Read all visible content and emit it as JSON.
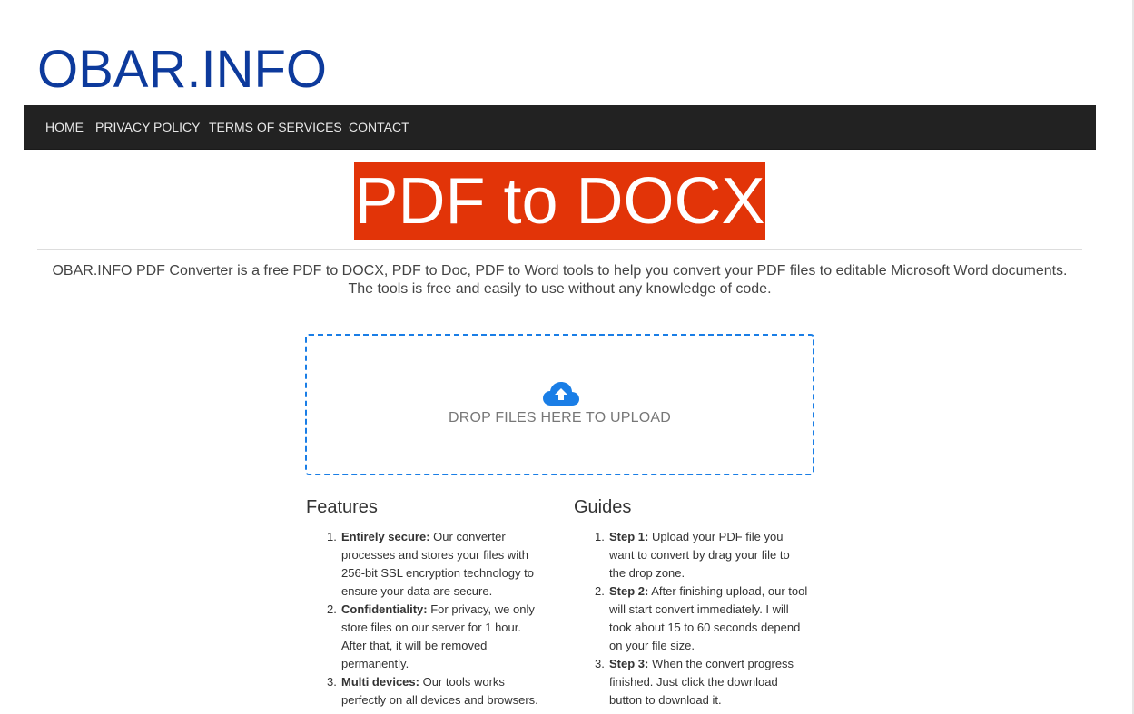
{
  "site": {
    "title": "OBAR.INFO"
  },
  "nav": {
    "items": [
      {
        "label": "HOME"
      },
      {
        "label": "PRIVACY POLICY"
      },
      {
        "label": "TERMS OF SERVICES"
      },
      {
        "label": "CONTACT"
      }
    ]
  },
  "hero": {
    "banner": "PDF to DOCX",
    "intro_line1": "OBAR.INFO PDF Converter is a free PDF to DOCX, PDF to Doc, PDF to Word tools to help you convert your PDF files to editable Microsoft Word documents.",
    "intro_line2": "The tools is free and easily to use without any knowledge of code."
  },
  "dropzone": {
    "icon": "cloud-upload-icon",
    "label": "DROP FILES HERE TO UPLOAD"
  },
  "features": {
    "heading": "Features",
    "items": [
      {
        "num": "1.",
        "title": "Entirely secure:",
        "text": "Our converter processes and stores your files with 256-bit SSL encryption technology to ensure your data are secure."
      },
      {
        "num": "2.",
        "title": "Confidentiality:",
        "text": "For privacy, we only store files on our server for 1 hour. After that, it will be removed permanently."
      },
      {
        "num": "3.",
        "title": "Multi devices:",
        "text": "Our tools works perfectly on all devices and browsers."
      }
    ]
  },
  "guides": {
    "heading": "Guides",
    "items": [
      {
        "num": "1.",
        "title": "Step 1:",
        "text": "Upload your PDF file you want to convert by drag your file to the drop zone."
      },
      {
        "num": "2.",
        "title": "Step 2:",
        "text": "After finishing upload, our tool will start convert immediately. I will took about 15 to 60 seconds depend on your file size."
      },
      {
        "num": "3.",
        "title": "Step 3:",
        "text": "When the convert progress finished. Just click the download button to download it."
      }
    ]
  },
  "colors": {
    "brand": "#0d3a9c",
    "banner": "#e23408",
    "navbar": "#222222",
    "accent": "#1a7ee6"
  }
}
